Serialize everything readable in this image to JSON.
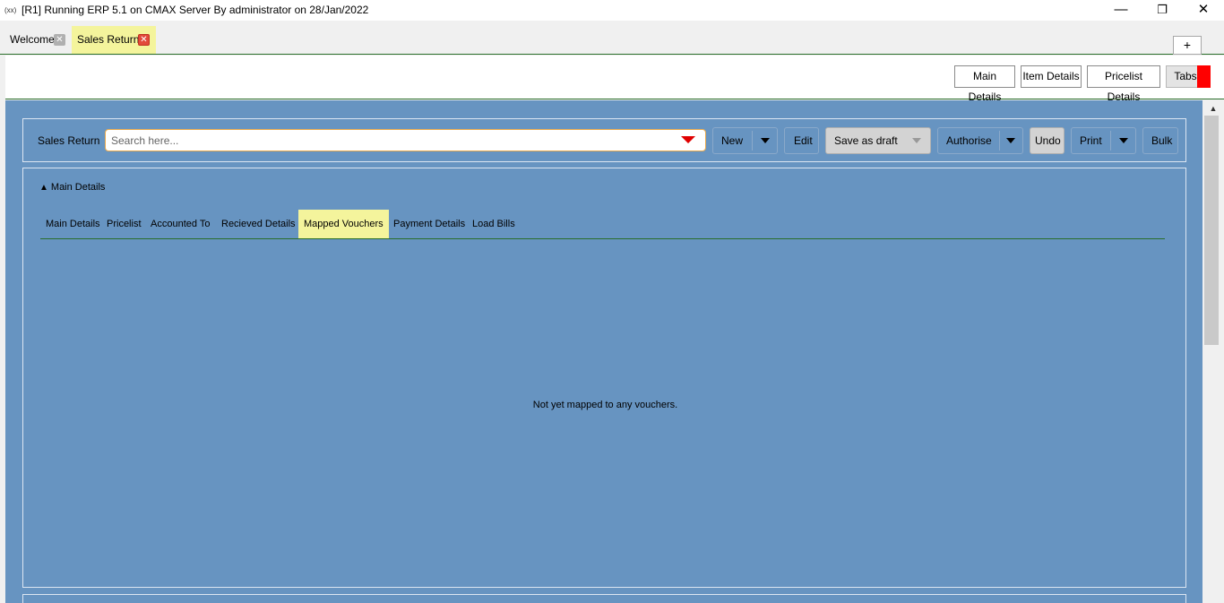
{
  "window": {
    "app_icon": "(xx)",
    "title": "[R1] Running ERP 5.1 on CMAX Server By administrator on 28/Jan/2022",
    "minimize": "—",
    "maximize": "❐",
    "close": "✕"
  },
  "doc_tabs": [
    {
      "label": "Welcome",
      "close": "✕"
    },
    {
      "label": "Sales Return",
      "close": "✕"
    }
  ],
  "new_tab_label": "+",
  "section_buttons": {
    "main_details": "Main Details",
    "item_details": "Item Details",
    "pricelist_details": "Pricelist Details",
    "tabs": "Tabs"
  },
  "action_bar": {
    "form_label": "Sales Return",
    "search_placeholder": "Search here...",
    "new": "New",
    "edit": "Edit",
    "save_as_draft": "Save as draft",
    "authorise": "Authorise",
    "undo": "Undo",
    "print": "Print",
    "bulk": "Bulk"
  },
  "details": {
    "collapse_icon": "▲",
    "collapse_label": "Main Details",
    "subtabs": [
      "Main Details",
      "Pricelist",
      "Accounted To",
      "Recieved Details",
      "Mapped Vouchers",
      "Payment Details",
      "Load Bills"
    ],
    "active_subtab": "Mapped Vouchers",
    "empty_message": "Not yet mapped to any vouchers."
  },
  "colors": {
    "content_bg": "#6794c1",
    "active_tab": "#f4f49c",
    "search_arrow": "#e00000",
    "tabs_marker": "#ff0000"
  }
}
